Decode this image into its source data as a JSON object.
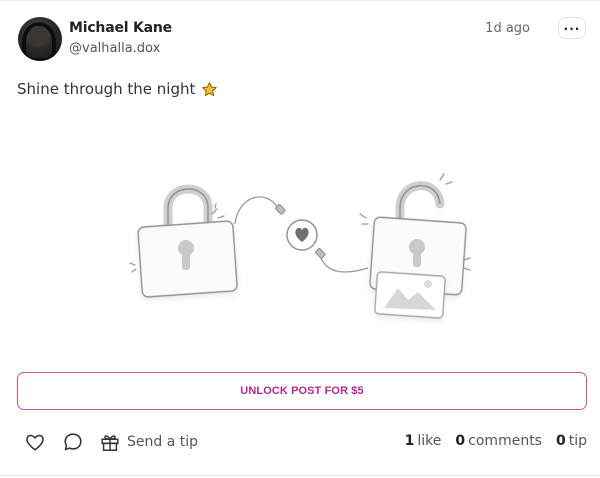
{
  "post": {
    "author": {
      "display_name": "Michael Kane",
      "handle": "@valhalla.dox"
    },
    "timestamp": "1d ago",
    "more_label": "...",
    "text": "Shine through the night",
    "text_emoji": "star-icon",
    "illustration": {
      "kind": "locked-content",
      "icons": [
        "locked-padlock-icon",
        "heart-icon",
        "unlocked-padlock-icon",
        "image-icon"
      ]
    }
  },
  "unlock": {
    "label": "UNLOCK POST FOR $5"
  },
  "actions": {
    "send_tip_label": "Send a tip"
  },
  "stats": {
    "likes_count": "1",
    "likes_label": "like",
    "comments_count": "0",
    "comments_label": "comments",
    "tips_count": "0",
    "tips_label": "tip"
  },
  "colors": {
    "accent": "#b32a8e",
    "accent_border": "#d14fa8",
    "star": "#f4b400"
  }
}
